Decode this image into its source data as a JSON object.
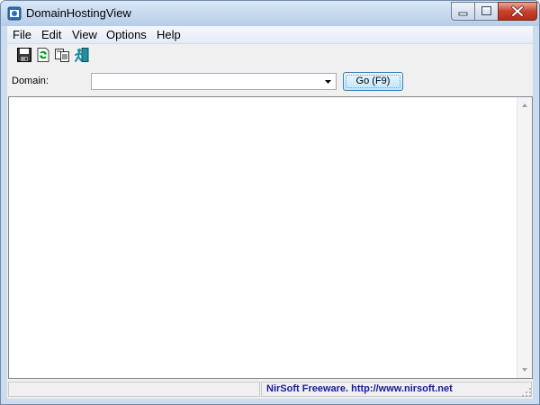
{
  "window": {
    "title": "DomainHostingView"
  },
  "menu": {
    "items": [
      "File",
      "Edit",
      "View",
      "Options",
      "Help"
    ]
  },
  "toolbar": {
    "icons": [
      "save-icon",
      "refresh-icon",
      "copy-icon",
      "exit-icon"
    ]
  },
  "domain": {
    "label": "Domain:",
    "value": "",
    "placeholder": ""
  },
  "go_button": {
    "label": "Go   (F9)"
  },
  "status": {
    "credit": "NirSoft Freeware.  http://www.nirsoft.net"
  },
  "colors": {
    "title_gradient_top": "#d9e7f5",
    "close_button": "#c7432f",
    "status_link": "#1a1a9c",
    "go_button_border": "#3c7fb1"
  }
}
